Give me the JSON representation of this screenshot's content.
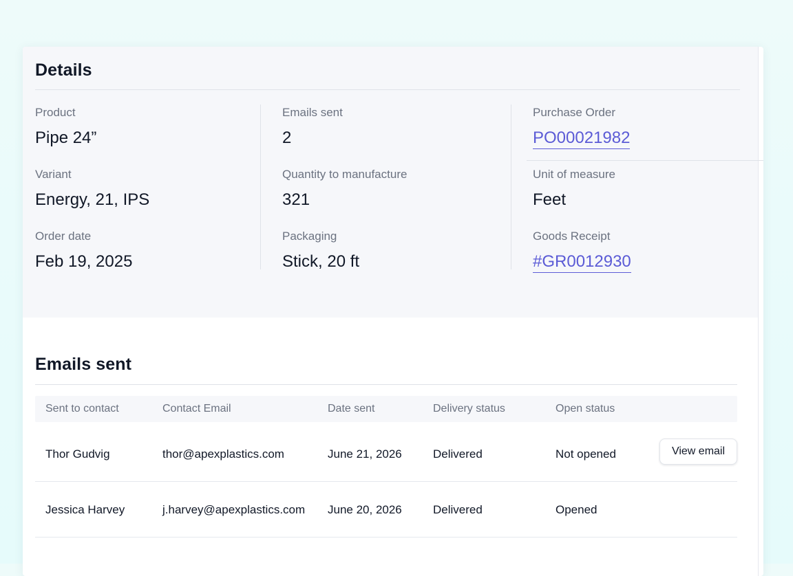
{
  "details": {
    "title": "Details",
    "product_label": "Product",
    "product_value": "Pipe 24”",
    "variant_label": "Variant",
    "variant_value": "Energy, 21, IPS",
    "order_date_label": "Order date",
    "order_date_value": "Feb 19, 2025",
    "emails_sent_label": "Emails sent",
    "emails_sent_value": "2",
    "quantity_label": "Quantity to manufacture",
    "quantity_value": "321",
    "packaging_label": "Packaging",
    "packaging_value": "Stick, 20 ft",
    "purchase_order_label": "Purchase Order",
    "purchase_order_value": "PO00021982",
    "unit_label": "Unit of measure",
    "unit_value": "Feet",
    "goods_receipt_label": "Goods Receipt",
    "goods_receipt_value": "#GR0012930"
  },
  "emails": {
    "title": "Emails sent",
    "columns": [
      "Sent to contact",
      "Contact Email",
      "Date sent",
      "Delivery status",
      "Open status"
    ],
    "rows": [
      {
        "contact": "Thor Gudvig",
        "email": "thor@apexplastics.com",
        "date": "June 21, 2026",
        "delivery": "Delivered",
        "open": "Not opened",
        "action": "View email"
      },
      {
        "contact": "Jessica Harvey",
        "email": "j.harvey@apexplastics.com",
        "date": "June 20, 2026",
        "delivery": "Delivered",
        "open": "Opened"
      }
    ]
  },
  "colors": {
    "link": "#5b5bd6",
    "panel_background": "#f6f7fa",
    "page_background": "#eafbfb"
  }
}
